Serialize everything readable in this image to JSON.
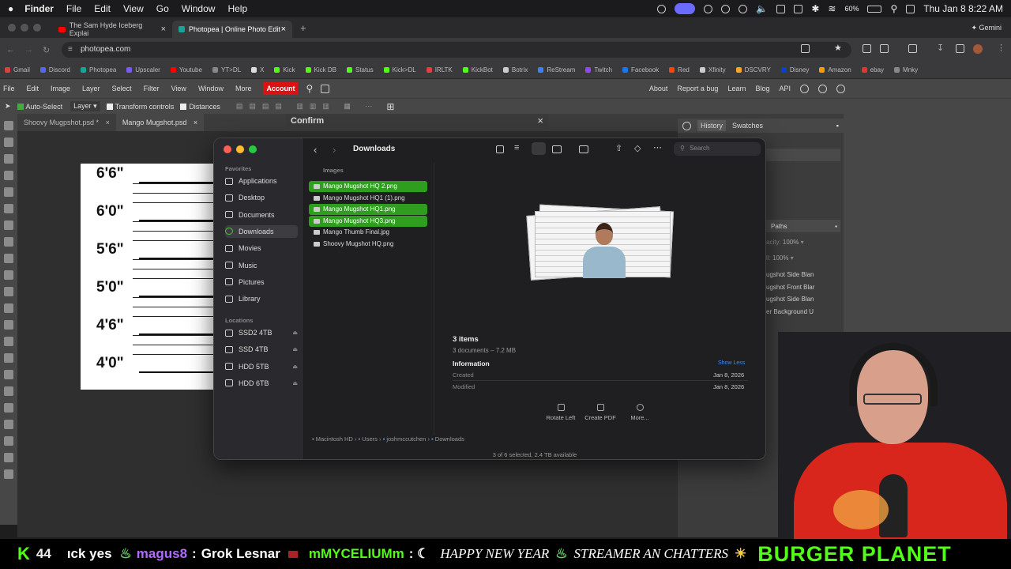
{
  "menubar": {
    "app": "Finder",
    "items": [
      "File",
      "Edit",
      "View",
      "Go",
      "Window",
      "Help"
    ],
    "battery": "60%",
    "clock": "Thu Jan 8  8:22 AM"
  },
  "browser": {
    "tabs": [
      {
        "title": "The Sam Hyde Iceberg Explai"
      },
      {
        "title": "Photopea | Online Photo Edit"
      }
    ],
    "new_tab": "+",
    "gemini": "Gemini",
    "url": "photopea.com",
    "bookmarks": [
      {
        "label": "Gmail",
        "color": "#d44638"
      },
      {
        "label": "Discord",
        "color": "#5865f2"
      },
      {
        "label": "Photopea",
        "color": "#18a497"
      },
      {
        "label": "Upscaler",
        "color": "#7a5af8"
      },
      {
        "label": "Youtube",
        "color": "#ff0000"
      },
      {
        "label": "YT>DL",
        "color": "#888888"
      },
      {
        "label": "X",
        "color": "#dddddd"
      },
      {
        "label": "Kick",
        "color": "#53fc18"
      },
      {
        "label": "Kick DB",
        "color": "#53fc18"
      },
      {
        "label": "Status",
        "color": "#53fc18"
      },
      {
        "label": "Kick>DL",
        "color": "#53fc18"
      },
      {
        "label": "IRLTK",
        "color": "#e04040"
      },
      {
        "label": "KickBot",
        "color": "#53fc18"
      },
      {
        "label": "Botrix",
        "color": "#cccccc"
      },
      {
        "label": "ReStream",
        "color": "#3b82f6"
      },
      {
        "label": "Twitch",
        "color": "#9146ff"
      },
      {
        "label": "Facebook",
        "color": "#1877f2"
      },
      {
        "label": "Red",
        "color": "#ff4500"
      },
      {
        "label": "Xfinity",
        "color": "#cccccc"
      },
      {
        "label": "DSCVRY",
        "color": "#f5a623"
      },
      {
        "label": "Disney",
        "color": "#113ccf"
      },
      {
        "label": "Amazon",
        "color": "#ff9900"
      },
      {
        "label": "ebay",
        "color": "#e53238"
      },
      {
        "label": "Mnky",
        "color": "#888888"
      }
    ]
  },
  "photopea": {
    "menu": [
      "File",
      "Edit",
      "Image",
      "Layer",
      "Select",
      "Filter",
      "View",
      "Window",
      "More"
    ],
    "account": "Account",
    "right_links": [
      "About",
      "Report a bug",
      "Learn",
      "Blog",
      "API"
    ],
    "options": {
      "auto_select": "Auto-Select",
      "layer": "Layer",
      "transform": "Transform controls",
      "distances": "Distances"
    },
    "doc_tabs": [
      "Shoovy Mugpshot.psd *",
      "Mango Mugshot.psd"
    ],
    "confirm_title": "Confirm",
    "panel_tabs": [
      "History",
      "Swatches"
    ],
    "paths_tab": "Paths",
    "opacity": "100%",
    "fill": "100%",
    "layers": [
      "ugshot Side Blan",
      "ugshot Front Blar",
      "ugshot Side Blan",
      "er Background U"
    ],
    "height_labels": [
      "6'6\"",
      "6'0\"",
      "5'6\"",
      "5'0\"",
      "4'6\"",
      "4'0\""
    ]
  },
  "finder": {
    "title": "Downloads",
    "search_placeholder": "Search",
    "favorites_header": "Favorites",
    "favorites": [
      "Applications",
      "Desktop",
      "Documents",
      "Downloads",
      "Movies",
      "Music",
      "Pictures",
      "Library"
    ],
    "locations_header": "Locations",
    "locations": [
      "SSD2 4TB",
      "SSD 4TB",
      "HDD 5TB",
      "HDD 6TB"
    ],
    "group_header": "Images",
    "files": [
      {
        "name": "Mango Mugshot HQ 2.png",
        "selected": true
      },
      {
        "name": "Mango Mugshot HQ1 (1).png",
        "selected": false
      },
      {
        "name": "Mango Mugshot HQ1.png",
        "selected": true
      },
      {
        "name": "Mango Mugshot HQ3.png",
        "selected": true
      },
      {
        "name": "Mango Thumb Final.jpg",
        "selected": false
      },
      {
        "name": "Shoovy Mugshot HQ.png",
        "selected": false
      }
    ],
    "summary_title": "3 items",
    "summary_sub": "3 documents – 7.2 MB",
    "info_header": "Information",
    "show_less": "Show Less",
    "created_label": "Created",
    "created_value": "Jan 8, 2026",
    "modified_label": "Modified",
    "modified_value": "Jan 8, 2026",
    "actions": [
      "Rotate Left",
      "Create PDF",
      "More..."
    ],
    "path": [
      "Macintosh HD",
      "Users",
      "joshmccutchen",
      "Downloads"
    ],
    "status": "3 of 6 selected, 2.4 TB available"
  },
  "ticker": {
    "count": "44",
    "segments": [
      "ıck yes",
      "magus8",
      "Grok Lesnar",
      "mMYCELIUMm",
      "HAPPY NEW YEAR",
      "STREAMER AN CHATTERS",
      "BURGER  PLANET"
    ]
  }
}
